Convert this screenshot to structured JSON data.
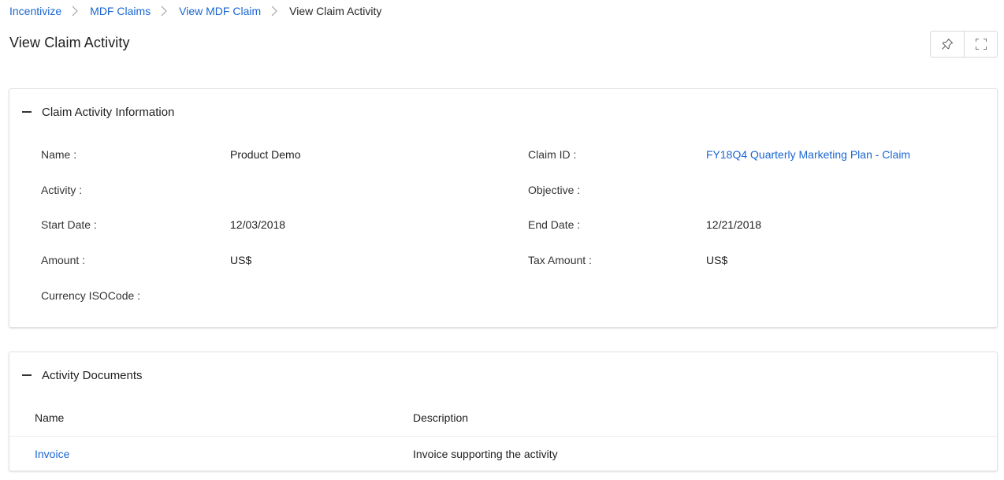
{
  "breadcrumb": {
    "items": [
      {
        "label": "Incentivize"
      },
      {
        "label": "MDF Claims"
      },
      {
        "label": "View MDF Claim"
      },
      {
        "label": "View Claim Activity"
      }
    ]
  },
  "page": {
    "title": "View Claim Activity"
  },
  "toolbar": {
    "pin_icon": "pin-icon",
    "fullscreen_icon": "expand-icon"
  },
  "info_panel": {
    "title": "Claim Activity Information",
    "fields": {
      "name": {
        "label": "Name :",
        "value": "Product Demo"
      },
      "claim_id": {
        "label": "Claim ID :",
        "value": "FY18Q4 Quarterly Marketing Plan - Claim"
      },
      "activity": {
        "label": "Activity :",
        "value": ""
      },
      "objective": {
        "label": "Objective :",
        "value": ""
      },
      "start_date": {
        "label": "Start Date :",
        "value": "12/03/2018"
      },
      "end_date": {
        "label": "End Date :",
        "value": "12/21/2018"
      },
      "amount": {
        "label": "Amount :",
        "value": "US$"
      },
      "tax_amount": {
        "label": "Tax Amount :",
        "value": "US$"
      },
      "currency": {
        "label": "Currency ISOCode :",
        "value": ""
      }
    }
  },
  "docs_panel": {
    "title": "Activity Documents",
    "columns": [
      "Name",
      "Description"
    ],
    "rows": [
      {
        "name": "Invoice",
        "description": "Invoice supporting the activity"
      }
    ]
  },
  "colors": {
    "link": "#1a66d2",
    "text": "#1f1f1f",
    "border": "#e2e2e2"
  }
}
